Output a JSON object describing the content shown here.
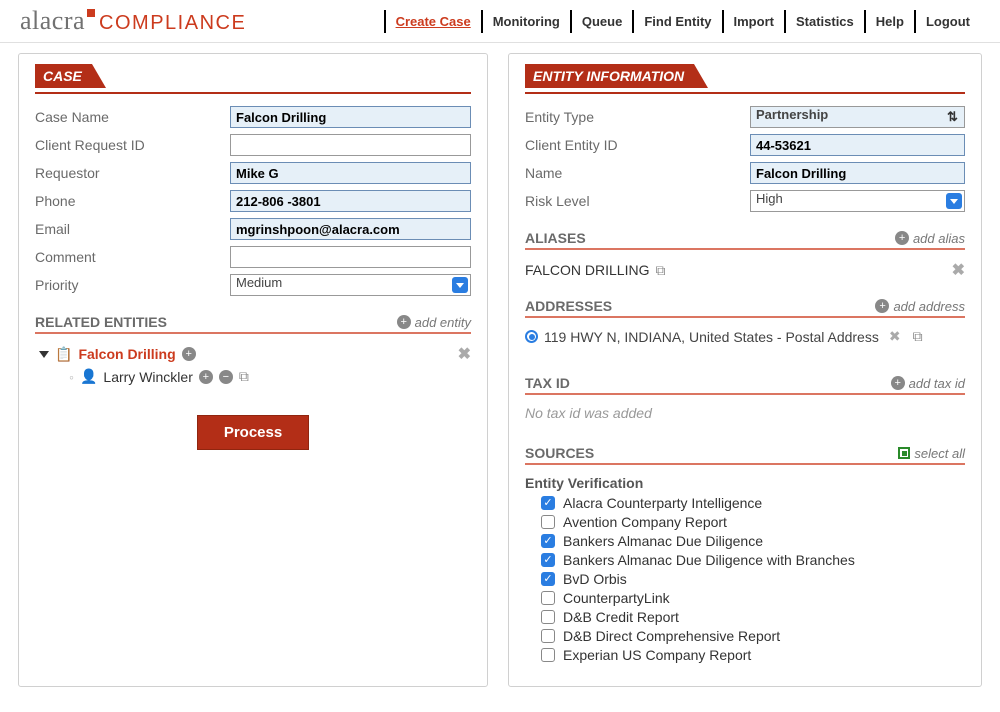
{
  "logo": {
    "brand": "alacra",
    "product": "COMPLIANCE"
  },
  "nav": {
    "create_case": "Create Case",
    "monitoring": "Monitoring",
    "queue": "Queue",
    "find_entity": "Find Entity",
    "import": "Import",
    "statistics": "Statistics",
    "help": "Help",
    "logout": "Logout"
  },
  "case": {
    "header": "CASE",
    "labels": {
      "case_name": "Case Name",
      "client_request_id": "Client Request ID",
      "requestor": "Requestor",
      "phone": "Phone",
      "email": "Email",
      "comment": "Comment",
      "priority": "Priority"
    },
    "values": {
      "case_name": "Falcon Drilling",
      "client_request_id": "",
      "requestor": "Mike G",
      "phone": "212-806 -3801",
      "email": "mgrinshpoon@alacra.com",
      "comment": "",
      "priority": "Medium"
    },
    "related_header": "RELATED ENTITIES",
    "add_entity": "add entity",
    "entities": [
      {
        "name": "Falcon Drilling",
        "people": [
          "Larry  Winckler"
        ]
      }
    ],
    "process": "Process"
  },
  "entity": {
    "header": "ENTITY INFORMATION",
    "labels": {
      "entity_type": "Entity Type",
      "client_entity_id": "Client Entity ID",
      "name": "Name",
      "risk_level": "Risk Level"
    },
    "values": {
      "entity_type": "Partnership",
      "client_entity_id": "44-53621",
      "name": "Falcon Drilling",
      "risk_level": "High"
    },
    "aliases_header": "ALIASES",
    "add_alias": "add alias",
    "aliases": [
      "FALCON DRILLING"
    ],
    "addresses_header": "ADDRESSES",
    "add_address": "add address",
    "addresses": [
      "119 HWY N,  INDIANA,  United States -  Postal Address"
    ],
    "taxid_header": "TAX ID",
    "add_taxid": "add tax id",
    "taxid_empty": "No tax id was added",
    "sources_header": "SOURCES",
    "select_all": "select all",
    "sources_group": "Entity Verification",
    "sources": [
      {
        "label": "Alacra Counterparty Intelligence",
        "checked": true
      },
      {
        "label": "Avention Company Report",
        "checked": false
      },
      {
        "label": "Bankers Almanac Due Diligence",
        "checked": true
      },
      {
        "label": "Bankers Almanac Due Diligence with Branches",
        "checked": true
      },
      {
        "label": "BvD Orbis",
        "checked": true
      },
      {
        "label": "CounterpartyLink",
        "checked": false
      },
      {
        "label": "D&B Credit Report",
        "checked": false
      },
      {
        "label": "D&B Direct Comprehensive Report",
        "checked": false
      },
      {
        "label": "Experian US Company Report",
        "checked": false
      }
    ]
  }
}
